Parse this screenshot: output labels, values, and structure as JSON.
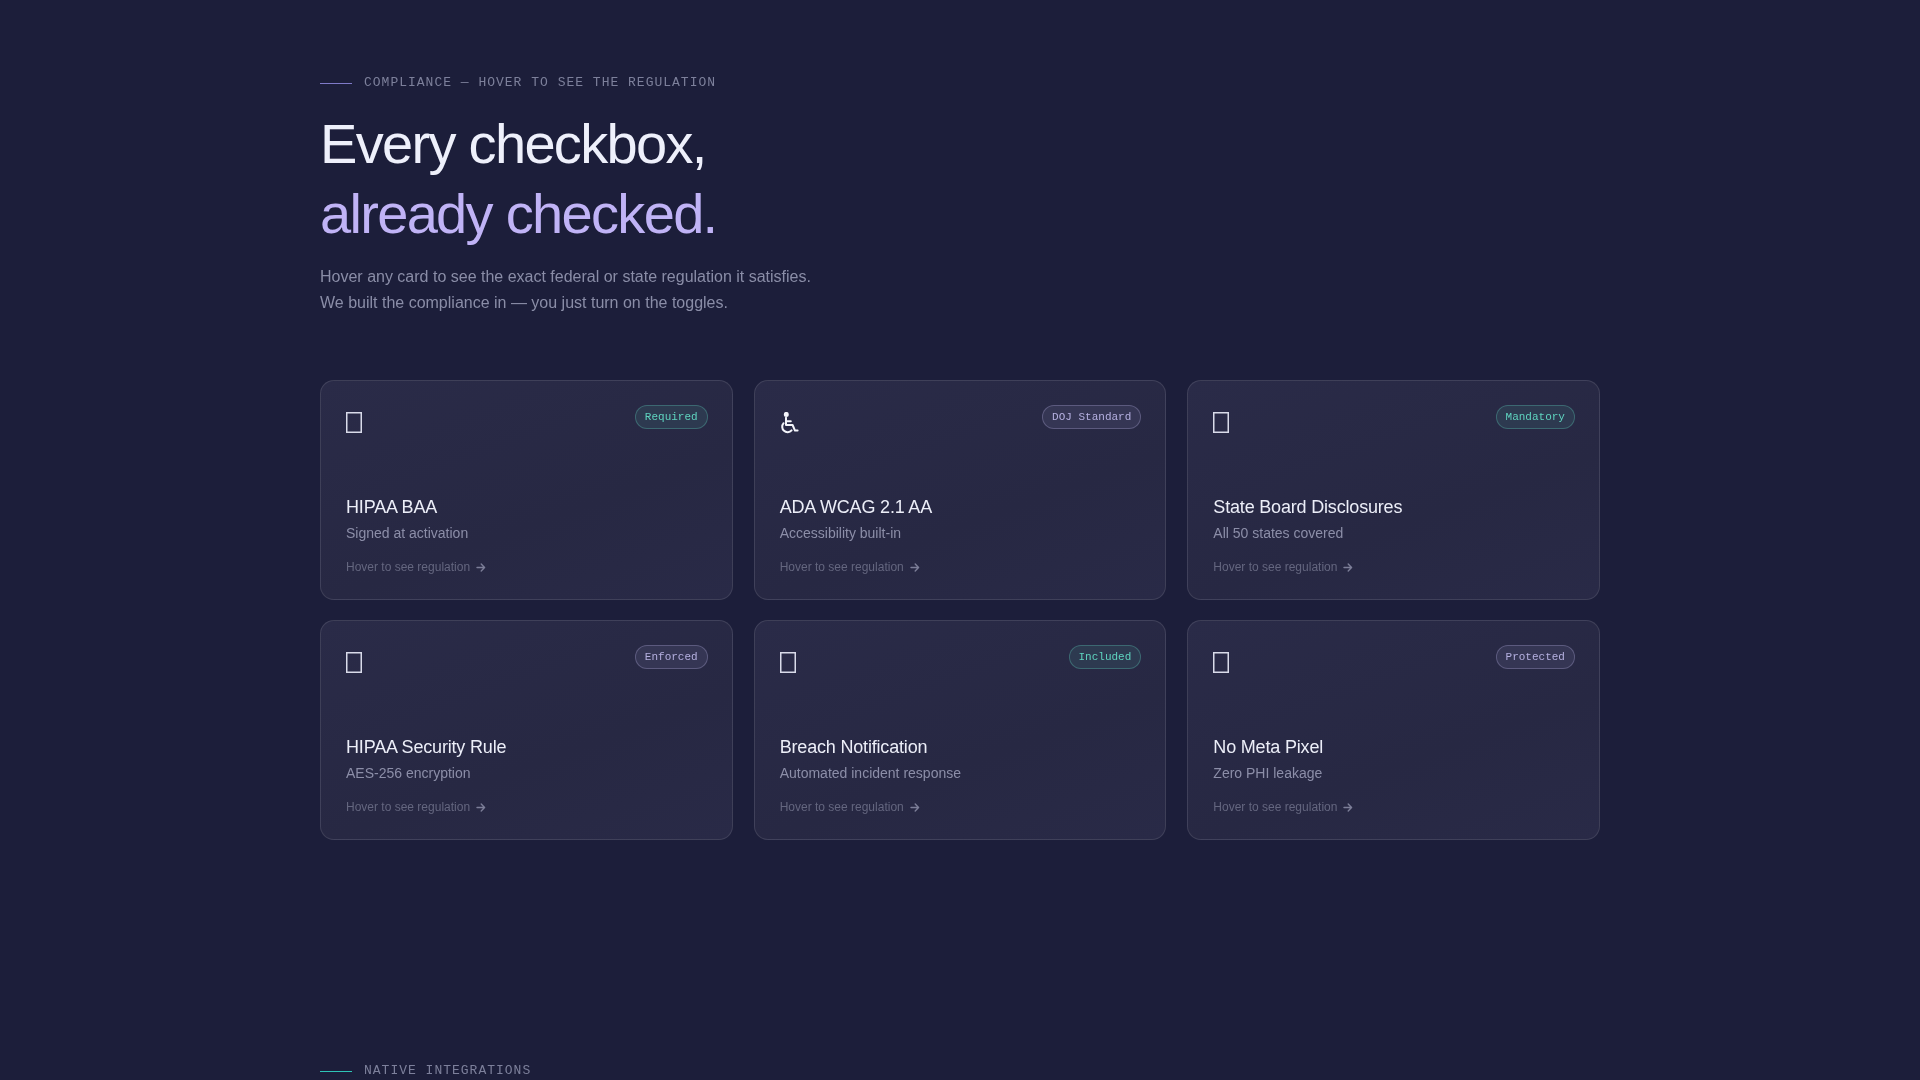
{
  "header": {
    "eyebrow": "COMPLIANCE — HOVER TO SEE THE REGULATION",
    "title": "Every checkbox,",
    "title_highlight": "already checked.",
    "description": [
      "Hover any card to see the exact federal or state regulation it satisfies.",
      "We built the compliance in — you just turn on the toggles."
    ]
  },
  "cards": [
    {
      "kind": "standard",
      "title": "HIPAA BAA",
      "subtitle": "Signed at activation",
      "badge": {
        "text": "Required",
        "color": "#5fd4bf"
      },
      "hint": "Hover to see regulation"
    },
    {
      "kind": "accessibility",
      "title": "ADA WCAG 2.1 AA",
      "subtitle": "Accessibility built-in",
      "badge": {
        "text": "DOJ Standard",
        "color": "#b5b0e0"
      },
      "hint": "Hover to see regulation"
    },
    {
      "kind": "standard",
      "title": "State Board Disclosures",
      "subtitle": "All 50 states covered",
      "badge": {
        "text": "Mandatory",
        "color": "#5fd4bf"
      },
      "hint": "Hover to see regulation"
    },
    {
      "kind": "standard",
      "title": "HIPAA Security Rule",
      "subtitle": "AES-256 encryption",
      "badge": {
        "text": "Enforced",
        "color": "#b5b0e0"
      },
      "hint": "Hover to see regulation"
    },
    {
      "kind": "standard",
      "title": "Breach Notification",
      "subtitle": "Automated incident response",
      "badge": {
        "text": "Included",
        "color": "#5fd4bf"
      },
      "hint": "Hover to see regulation"
    },
    {
      "kind": "standard",
      "title": "No Meta Pixel",
      "subtitle": "Zero PHI leakage",
      "badge": {
        "text": "Protected",
        "color": "#b5b0e0"
      },
      "hint": "Hover to see regulation"
    }
  ],
  "next_section": {
    "eyebrow": "NATIVE INTEGRATIONS"
  }
}
